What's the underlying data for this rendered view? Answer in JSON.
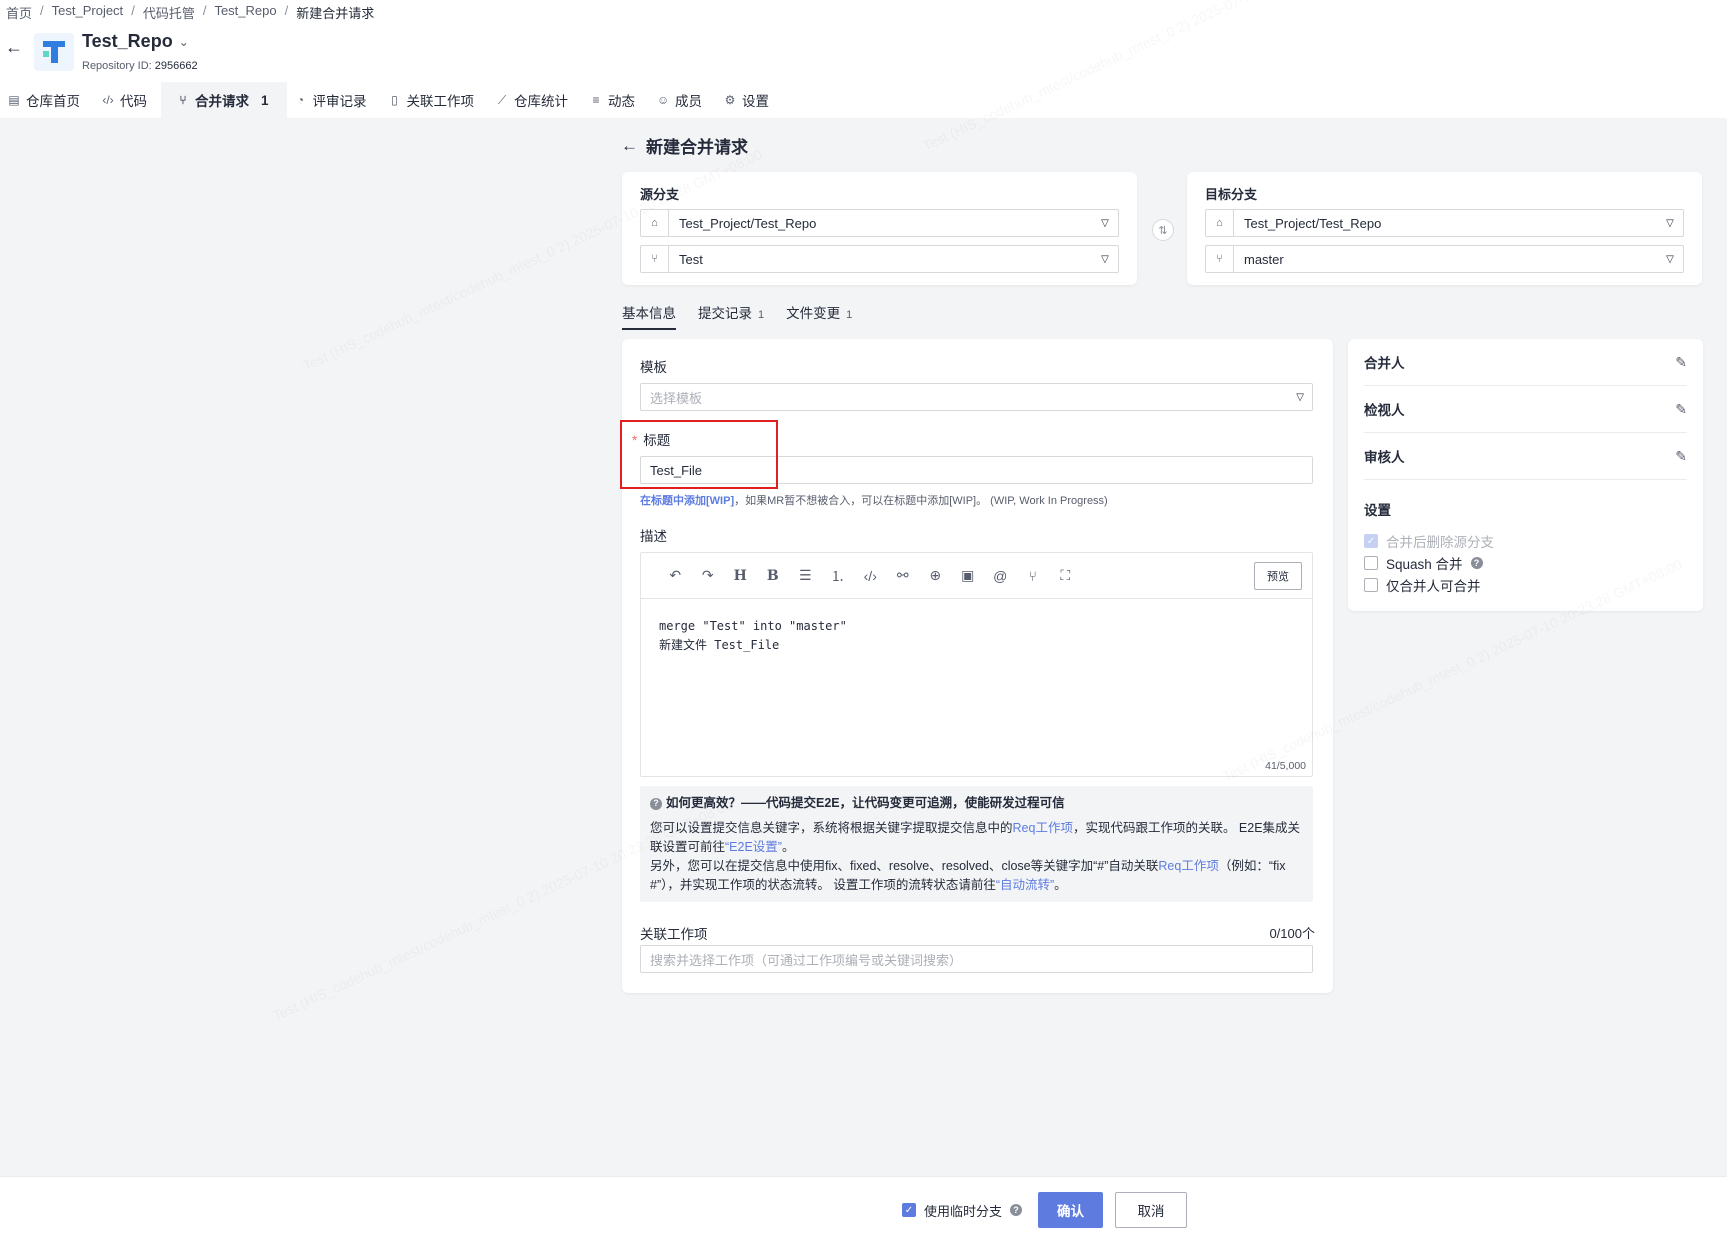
{
  "breadcrumb": [
    "首页",
    "Test_Project",
    "代码托管",
    "Test_Repo",
    "新建合并请求"
  ],
  "repo": {
    "name": "Test_Repo",
    "id_label": "Repository ID:",
    "id_value": "2956662"
  },
  "nav": [
    {
      "label": "仓库首页",
      "icon": "▤"
    },
    {
      "label": "代码",
      "icon": "‹/›"
    },
    {
      "label": "合并请求",
      "icon": "⑂",
      "badge": "1",
      "active": true
    },
    {
      "label": "评审记录",
      "icon": "◔"
    },
    {
      "label": "关联工作项",
      "icon": "▯"
    },
    {
      "label": "仓库统计",
      "icon": "⟋"
    },
    {
      "label": "动态",
      "icon": "≡"
    },
    {
      "label": "成员",
      "icon": "☺"
    },
    {
      "label": "设置",
      "icon": "⚙"
    }
  ],
  "page_title": "新建合并请求",
  "source": {
    "label": "源分支",
    "repo": "Test_Project/Test_Repo",
    "branch": "Test"
  },
  "target": {
    "label": "目标分支",
    "repo": "Test_Project/Test_Repo",
    "branch": "master"
  },
  "tabs": [
    {
      "label": "基本信息",
      "count": ""
    },
    {
      "label": "提交记录",
      "count": "1"
    },
    {
      "label": "文件变更",
      "count": "1"
    }
  ],
  "form": {
    "template_label": "模板",
    "template_placeholder": "选择模板",
    "title_label": "标题",
    "title_required": "*",
    "title_value": "Test_File",
    "hint_link": "在标题中添加[WIP]",
    "hint_text": "，如果MR暂不想被合入，可以在标题中添加[WIP]。 (WIP, Work In Progress)",
    "desc_label": "描述",
    "preview_label": "预览",
    "desc_line1": "merge \"Test\" into \"master\"",
    "desc_line2": "新建文件 Test_File",
    "char_count": "41/5,000",
    "tip_title": "如何更高效？——代码提交E2E，让代码变更可追溯，使能研发过程可信",
    "tip_p1_a": "您可以设置提交信息关键字，系统将根据关键字提取提交信息中的",
    "tip_p1_link1": "Req工作项",
    "tip_p1_b": "，实现代码跟工作项的关联。 E2E集成关联设置可前往",
    "tip_p1_link2": "“E2E设置”",
    "tip_p1_c": "。",
    "tip_p2_a": "另外，您可以在提交信息中使用fix、fixed、resolve、resolved、close等关键字加“#”自动关联",
    "tip_p2_link1": "Req工作项",
    "tip_p2_b": "（例如：“fix #”），并实现工作项的状态流转。 设置工作项的流转状态请前往",
    "tip_p2_link2": "“自动流转”",
    "tip_p2_c": "。",
    "workitem_label": "关联工作项",
    "workitem_count": "0/100个",
    "workitem_placeholder": "搜索并选择工作项（可通过工作项编号或关键词搜索）"
  },
  "side": {
    "merger": "合并人",
    "reviewer": "检视人",
    "approver": "审核人",
    "settings_label": "设置",
    "opt_delete_source": "合并后删除源分支",
    "opt_squash": "Squash 合并",
    "opt_merger_only": "仅合并人可合并"
  },
  "footer": {
    "temp_branch": "使用临时分支",
    "confirm": "确认",
    "cancel": "取消"
  },
  "watermark": "Test (HIS_codehub_mtest/codehub_mtest_0 2) 2025-07-10 20:23:28 GMT+08:00",
  "colors": {
    "primary": "#5e7ce0",
    "link": "#5e7ce0",
    "highlight": "#e02020",
    "required": "#f66f6a"
  }
}
